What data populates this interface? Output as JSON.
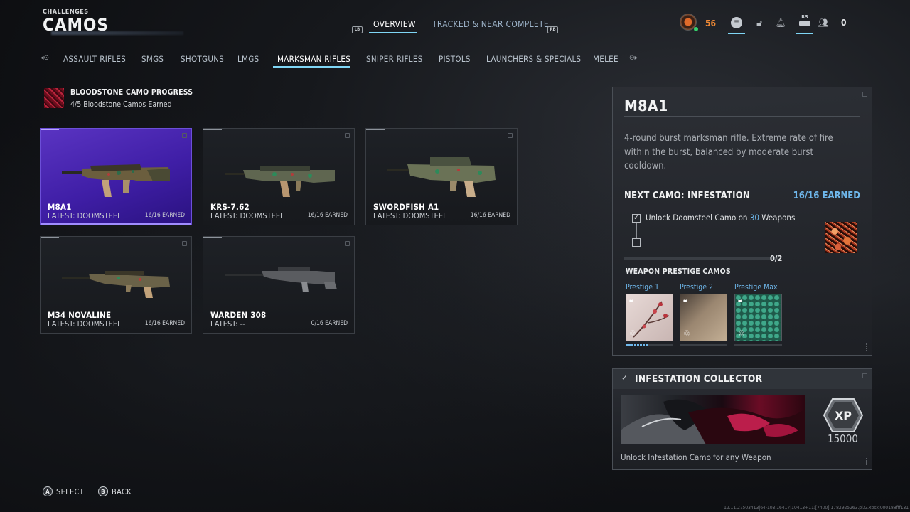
{
  "header": {
    "section": "CHALLENGES",
    "title": "CAMOS",
    "left_bumper": "LB",
    "right_bumper": "RB",
    "tabs": [
      "OVERVIEW",
      "TRACKED & NEAR COMPLETE"
    ],
    "active_tab": "OVERVIEW"
  },
  "topbar": {
    "level": "56",
    "rs_label": "RS",
    "social_count": "0",
    "level_color": "#f08a35"
  },
  "categories": {
    "items": [
      "ASSAULT RIFLES",
      "SMGS",
      "SHOTGUNS",
      "LMGS",
      "MARKSMAN RIFLES",
      "SNIPER RIFLES",
      "PISTOLS",
      "LAUNCHERS & SPECIALS",
      "MELEE"
    ],
    "active": "MARKSMAN RIFLES"
  },
  "bloodstone": {
    "title": "BLOODSTONE CAMO PROGRESS",
    "subtitle": "4/5 Bloodstone Camos Earned"
  },
  "weapons": [
    {
      "name": "M8A1",
      "latest": "LATEST: DOOMSTEEL",
      "earned": "16/16 EARNED",
      "selected": true
    },
    {
      "name": "KRS-7.62",
      "latest": "LATEST: DOOMSTEEL",
      "earned": "16/16 EARNED",
      "selected": false
    },
    {
      "name": "SWORDFISH A1",
      "latest": "LATEST: DOOMSTEEL",
      "earned": "16/16 EARNED",
      "selected": false
    },
    {
      "name": "M34 NOVALINE",
      "latest": "LATEST: DOOMSTEEL",
      "earned": "16/16 EARNED",
      "selected": false
    },
    {
      "name": "WARDEN 308",
      "latest": "LATEST: --",
      "earned": "0/16 EARNED",
      "selected": false
    }
  ],
  "detail": {
    "title": "M8A1",
    "description": "4-round burst marksman rifle. Extreme rate of fire within the burst, balanced by moderate burst cooldown.",
    "next_camo": "NEXT CAMO: INFESTATION",
    "earned": "16/16 EARNED",
    "task_prefix": "Unlock Doomsteel Camo on ",
    "task_count": "30",
    "task_suffix": " Weapons",
    "progress_text": "0/2",
    "progress": 0,
    "prestige_header": "WEAPON PRESTIGE CAMOS",
    "prestige": [
      "Prestige 1",
      "Prestige 2",
      "Prestige Max"
    ],
    "accent": "#6fb8ec"
  },
  "collector": {
    "title": "INFESTATION COLLECTOR",
    "xp_label": "XP",
    "xp": "15000",
    "description": "Unlock Infestation Camo for any Weapon"
  },
  "footer": {
    "a_glyph": "A",
    "select": "SELECT",
    "b_glyph": "B",
    "back": "BACK",
    "build": "12.11.27503413|64-103.16417|10413+11:[7400]|1782925263.pl.G.xbsx|000188fff131"
  }
}
